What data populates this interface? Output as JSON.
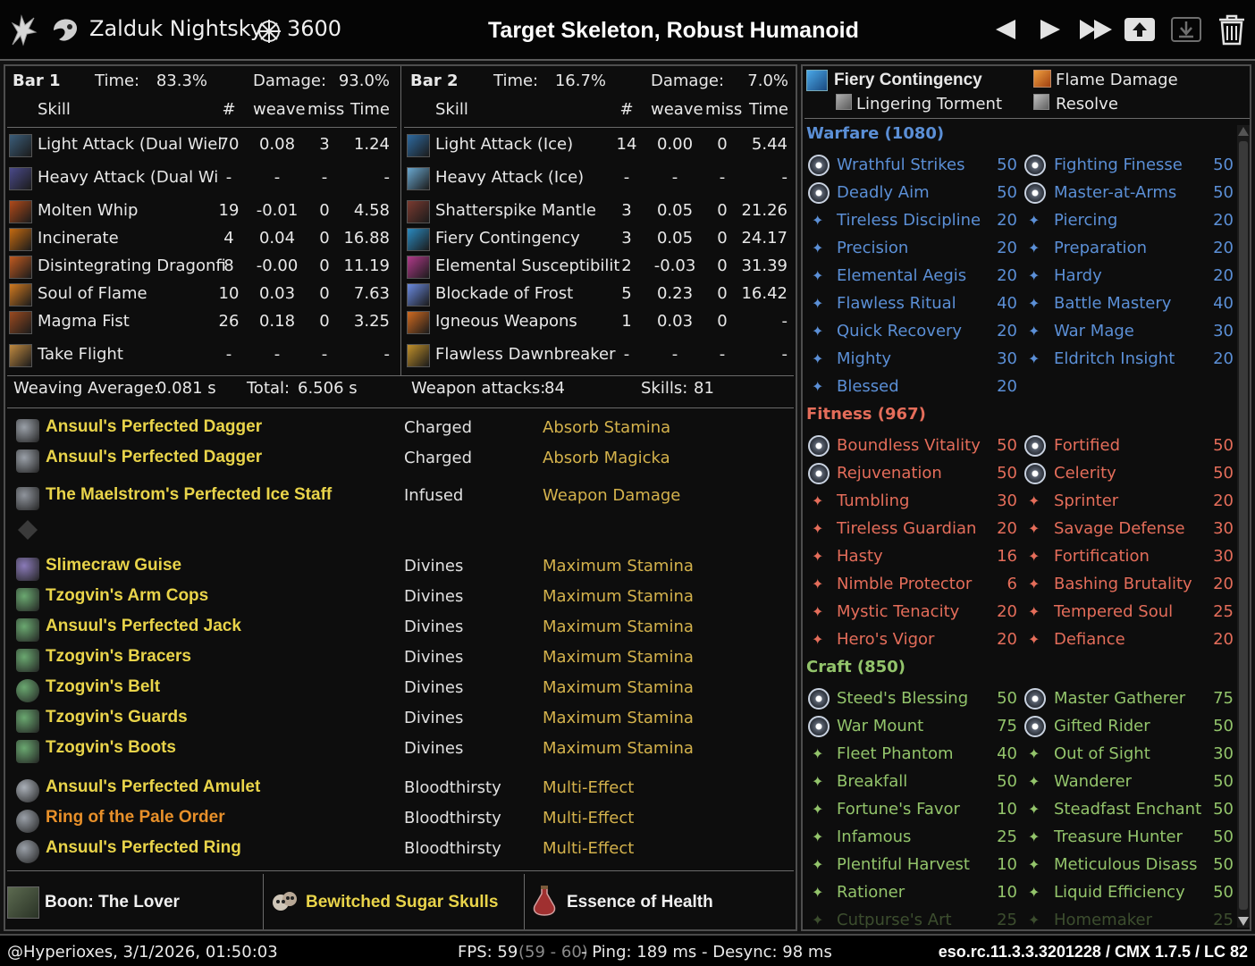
{
  "header": {
    "player_name": "Zalduk Nightsky",
    "cp_total": "3600",
    "target": "Target Skeleton, Robust Humanoid",
    "nav_icons": [
      "prev-icon",
      "next-icon",
      "fast-forward-icon",
      "upload-icon",
      "download-icon",
      "trash-icon"
    ]
  },
  "bar1": {
    "label": "Bar 1",
    "time_label": "Time:",
    "time": "83.3%",
    "damage_label": "Damage:",
    "damage": "93.0%",
    "col_skill": "Skill",
    "col_count": "#",
    "col_weave": "weave",
    "col_miss": "miss",
    "col_time": "Time",
    "rows": [
      {
        "name": "Light Attack (Dual Wiel",
        "count": "70",
        "weave": "0.08",
        "miss": "3",
        "time": "1.24",
        "icon_color": "#3b5d7a"
      },
      {
        "name": "Heavy Attack (Dual Wi",
        "count": "-",
        "weave": "-",
        "miss": "-",
        "time": "-",
        "icon_color": "#4a4a8a"
      },
      {
        "name": "Molten Whip",
        "count": "19",
        "weave": "-0.01",
        "miss": "0",
        "time": "4.58",
        "icon_color": "#b04a1a"
      },
      {
        "name": "Incinerate",
        "count": "4",
        "weave": "0.04",
        "miss": "0",
        "time": "16.88",
        "icon_color": "#c46a10"
      },
      {
        "name": "Disintegrating Dragonfi",
        "count": "8",
        "weave": "-0.00",
        "miss": "0",
        "time": "11.19",
        "icon_color": "#c05a20"
      },
      {
        "name": "Soul of Flame",
        "count": "10",
        "weave": "0.03",
        "miss": "0",
        "time": "7.63",
        "icon_color": "#d07a20"
      },
      {
        "name": "Magma Fist",
        "count": "26",
        "weave": "0.18",
        "miss": "0",
        "time": "3.25",
        "icon_color": "#9a4a20"
      },
      {
        "name": "Take Flight",
        "count": "-",
        "weave": "-",
        "miss": "-",
        "time": "-",
        "icon_color": "#c08a40"
      }
    ]
  },
  "bar2": {
    "label": "Bar 2",
    "time_label": "Time:",
    "time": "16.7%",
    "damage_label": "Damage:",
    "damage": "7.0%",
    "col_skill": "Skill",
    "col_count": "#",
    "col_weave": "weave",
    "col_miss": "miss",
    "col_time": "Time",
    "rows": [
      {
        "name": "Light Attack (Ice)",
        "count": "14",
        "weave": "0.00",
        "miss": "0",
        "time": "5.44",
        "icon_color": "#2e6aa0"
      },
      {
        "name": "Heavy Attack (Ice)",
        "count": "-",
        "weave": "-",
        "miss": "-",
        "time": "-",
        "icon_color": "#6aa8d0"
      },
      {
        "name": "Shatterspike Mantle",
        "count": "3",
        "weave": "0.05",
        "miss": "0",
        "time": "21.26",
        "icon_color": "#7a3a30"
      },
      {
        "name": "Fiery Contingency",
        "count": "3",
        "weave": "0.05",
        "miss": "0",
        "time": "24.17",
        "icon_color": "#2a8ac0"
      },
      {
        "name": "Elemental Susceptibilit",
        "count": "2",
        "weave": "-0.03",
        "miss": "0",
        "time": "31.39",
        "icon_color": "#b03a8a"
      },
      {
        "name": "Blockade of Frost",
        "count": "5",
        "weave": "0.23",
        "miss": "0",
        "time": "16.42",
        "icon_color": "#6a8ae0"
      },
      {
        "name": "Igneous Weapons",
        "count": "1",
        "weave": "0.03",
        "miss": "0",
        "time": "-",
        "icon_color": "#d06a20"
      },
      {
        "name": "Flawless Dawnbreaker",
        "count": "-",
        "weave": "-",
        "miss": "-",
        "time": "-",
        "icon_color": "#c0902a"
      }
    ]
  },
  "stats": {
    "weaving_label": "Weaving Average:",
    "weaving_value": "0.081 s",
    "total_label": "Total:",
    "total_value": "6.506 s",
    "weapon_label": "Weapon attacks:",
    "weapon_value": "84",
    "skills_label": "Skills:",
    "skills_value": "81"
  },
  "gear": [
    {
      "name": "Ansuul's Perfected Dagger",
      "trait": "Charged",
      "enchant": "Absorb Stamina",
      "color": "#e9d44a",
      "icon": "dagger-icon"
    },
    {
      "name": "Ansuul's Perfected Dagger",
      "trait": "Charged",
      "enchant": "Absorb Magicka",
      "color": "#e9d44a",
      "icon": "dagger-icon"
    },
    {
      "name": "The Maelstrom's Perfected Ice Staff",
      "trait": "Infused",
      "enchant": "Weapon Damage",
      "color": "#e9d44a",
      "icon": "staff-icon"
    },
    {
      "name": "Slimecraw Guise",
      "trait": "Divines",
      "enchant": "Maximum Stamina",
      "color": "#e9d44a",
      "icon": "helmet-icon"
    },
    {
      "name": "Tzogvin's Arm Cops",
      "trait": "Divines",
      "enchant": "Maximum Stamina",
      "color": "#e9d44a",
      "icon": "shoulder-icon"
    },
    {
      "name": "Ansuul's Perfected Jack",
      "trait": "Divines",
      "enchant": "Maximum Stamina",
      "color": "#e9d44a",
      "icon": "chest-icon"
    },
    {
      "name": "Tzogvin's Bracers",
      "trait": "Divines",
      "enchant": "Maximum Stamina",
      "color": "#e9d44a",
      "icon": "gloves-icon"
    },
    {
      "name": "Tzogvin's Belt",
      "trait": "Divines",
      "enchant": "Maximum Stamina",
      "color": "#e9d44a",
      "icon": "belt-icon"
    },
    {
      "name": "Tzogvin's Guards",
      "trait": "Divines",
      "enchant": "Maximum Stamina",
      "color": "#e9d44a",
      "icon": "legs-icon"
    },
    {
      "name": "Tzogvin's Boots",
      "trait": "Divines",
      "enchant": "Maximum Stamina",
      "color": "#e9d44a",
      "icon": "boots-icon"
    },
    {
      "name": "Ansuul's Perfected Amulet",
      "trait": "Bloodthirsty",
      "enchant": "Multi-Effect",
      "color": "#e9d44a",
      "icon": "amulet-icon"
    },
    {
      "name": "Ring of the Pale Order",
      "trait": "Bloodthirsty",
      "enchant": "Multi-Effect",
      "color": "#e8902a",
      "icon": "ring-icon"
    },
    {
      "name": "Ansuul's Perfected Ring",
      "trait": "Bloodthirsty",
      "enchant": "Multi-Effect",
      "color": "#e9d44a",
      "icon": "ring-icon"
    }
  ],
  "buffs": {
    "boon": "Boon: The Lover",
    "food": "Bewitched Sugar Skulls",
    "drink": "Essence of Health"
  },
  "cp": {
    "slotted": [
      {
        "name": "Fiery Contingency"
      },
      {
        "name": "Flame Damage"
      },
      {
        "name": "Lingering Torment"
      },
      {
        "name": "Resolve"
      }
    ],
    "categories": [
      {
        "title": "Warfare (1080)",
        "color": "#5b8fd6",
        "rows": [
          {
            "l": "Wrathful Strikes",
            "lv": "50",
            "r": "Fighting Finesse",
            "rv": "50",
            "slot": true
          },
          {
            "l": "Deadly Aim",
            "lv": "50",
            "r": "Master-at-Arms",
            "rv": "50",
            "slot": true
          },
          {
            "l": "Tireless Discipline",
            "lv": "20",
            "r": "Piercing",
            "rv": "20",
            "slot": false
          },
          {
            "l": "Precision",
            "lv": "20",
            "r": "Preparation",
            "rv": "20",
            "slot": false
          },
          {
            "l": "Elemental Aegis",
            "lv": "20",
            "r": "Hardy",
            "rv": "20",
            "slot": false
          },
          {
            "l": "Flawless Ritual",
            "lv": "40",
            "r": "Battle Mastery",
            "rv": "40",
            "slot": false
          },
          {
            "l": "Quick Recovery",
            "lv": "20",
            "r": "War Mage",
            "rv": "30",
            "slot": false
          },
          {
            "l": "Mighty",
            "lv": "30",
            "r": "Eldritch Insight",
            "rv": "20",
            "slot": false
          },
          {
            "l": "Blessed",
            "lv": "20",
            "r": "",
            "rv": "",
            "slot": false
          }
        ]
      },
      {
        "title": "Fitness (967)",
        "color": "#e46d5a",
        "rows": [
          {
            "l": "Boundless Vitality",
            "lv": "50",
            "r": "Fortified",
            "rv": "50",
            "slot": true
          },
          {
            "l": "Rejuvenation",
            "lv": "50",
            "r": "Celerity",
            "rv": "50",
            "slot": true
          },
          {
            "l": "Tumbling",
            "lv": "30",
            "r": "Sprinter",
            "rv": "20",
            "slot": false
          },
          {
            "l": "Tireless Guardian",
            "lv": "20",
            "r": "Savage Defense",
            "rv": "30",
            "slot": false
          },
          {
            "l": "Hasty",
            "lv": "16",
            "r": "Fortification",
            "rv": "30",
            "slot": false
          },
          {
            "l": "Nimble Protector",
            "lv": "6",
            "r": "Bashing Brutality",
            "rv": "20",
            "slot": false
          },
          {
            "l": "Mystic Tenacity",
            "lv": "20",
            "r": "Tempered Soul",
            "rv": "25",
            "slot": false
          },
          {
            "l": "Hero's Vigor",
            "lv": "20",
            "r": "Defiance",
            "rv": "20",
            "slot": false
          }
        ]
      },
      {
        "title": "Craft (850)",
        "color": "#93c46b",
        "rows": [
          {
            "l": "Steed's Blessing",
            "lv": "50",
            "r": "Master Gatherer",
            "rv": "75",
            "slot": true
          },
          {
            "l": "War Mount",
            "lv": "75",
            "r": "Gifted Rider",
            "rv": "50",
            "slot": true
          },
          {
            "l": "Fleet Phantom",
            "lv": "40",
            "r": "Out of Sight",
            "rv": "30",
            "slot": false
          },
          {
            "l": "Breakfall",
            "lv": "50",
            "r": "Wanderer",
            "rv": "50",
            "slot": false
          },
          {
            "l": "Fortune's Favor",
            "lv": "10",
            "r": "Steadfast Enchant",
            "rv": "50",
            "slot": false
          },
          {
            "l": "Infamous",
            "lv": "25",
            "r": "Treasure Hunter",
            "rv": "50",
            "slot": false
          },
          {
            "l": "Plentiful Harvest",
            "lv": "10",
            "r": "Meticulous Disass",
            "rv": "50",
            "slot": false
          },
          {
            "l": "Rationer",
            "lv": "10",
            "r": "Liquid Efficiency",
            "rv": "50",
            "slot": false
          },
          {
            "l": "Cutpurse's Art",
            "lv": "25",
            "r": "Homemaker",
            "rv": "25",
            "slot": false
          }
        ]
      }
    ]
  },
  "footer": {
    "user_time": "@Hyperioxes, 3/1/2026, 01:50:03",
    "fps_label": "FPS: 59",
    "fps_range": "(59 - 60)",
    "ping": "- Ping: 189 ms - Desync: 98 ms",
    "version": "eso.rc.11.3.3.3201228 / CMX 1.7.5 / LC 82"
  }
}
